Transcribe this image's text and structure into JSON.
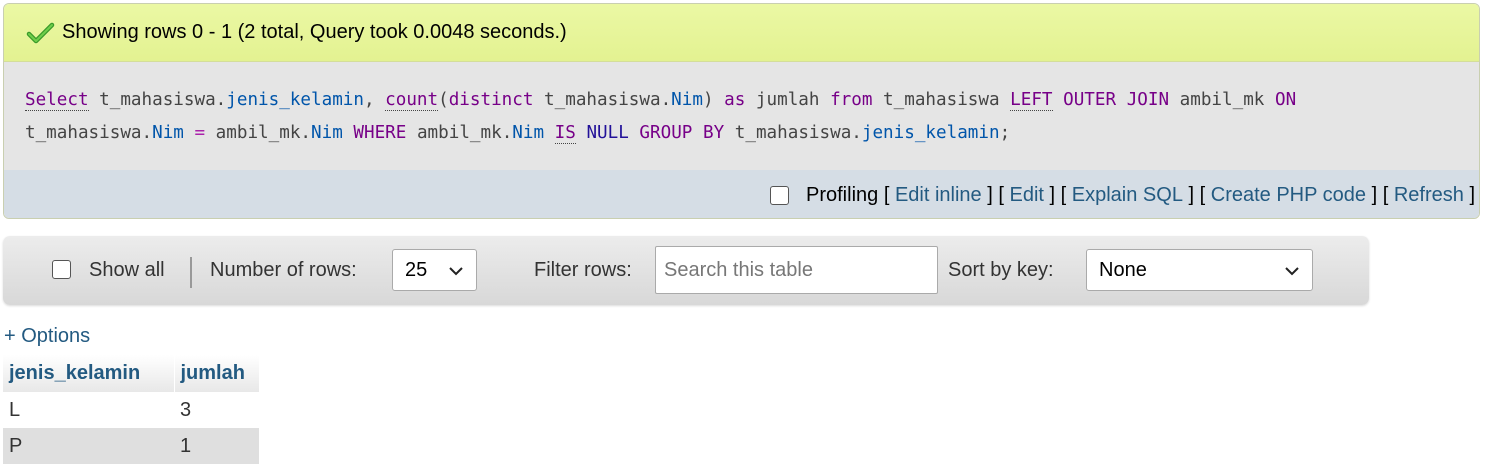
{
  "status": {
    "message": "Showing rows 0 - 1 (2 total, Query took 0.0048 seconds.)",
    "icon": "check-icon",
    "color": "#ebf8a4"
  },
  "sql": {
    "t1_select": "Select",
    "t2": " t_mahasiswa.",
    "t3_col": "jenis_kelamin",
    "t4": ", ",
    "t5_count": "count",
    "t6": "(",
    "t7_distinct": "distinct",
    "t8": " t_mahasiswa.",
    "t9_col": "Nim",
    "t10": ") ",
    "t11_as": "as",
    "t12": " jumlah ",
    "t13_from": "from",
    "t14": " t_mahasiswa ",
    "t15_left": "LEFT",
    "t16": " ",
    "t17_outer": "OUTER",
    "t18": " ",
    "t19_join": "JOIN",
    "t20": " ambil_mk ",
    "t21_on": "ON",
    "l2_t1": "t_mahasiswa.",
    "l2_t2_col": "Nim",
    "l2_t3": " ",
    "l2_t4_eq": "=",
    "l2_t5": " ambil_mk.",
    "l2_t6_col": "Nim",
    "l2_t7": " ",
    "l2_t8_where": "WHERE",
    "l2_t9": " ambil_mk.",
    "l2_t10_col": "Nim",
    "l2_t11": " ",
    "l2_t12_is": "IS",
    "l2_t13": " ",
    "l2_t14_null": "NULL",
    "l2_t15": " ",
    "l2_t16_group": "GROUP",
    "l2_t17": " ",
    "l2_t18_by": "BY",
    "l2_t19": " t_mahasiswa.",
    "l2_t20_col": "jenis_kelamin",
    "l2_t21": ";"
  },
  "tools": {
    "profiling": "Profiling",
    "bracket_open": "[",
    "bracket_close": "]",
    "edit_inline": "Edit inline",
    "edit": "Edit",
    "explain": "Explain SQL",
    "create_php": "Create PHP code",
    "refresh": "Refresh"
  },
  "nav": {
    "show_all": "Show all",
    "rows_label": "Number of rows:",
    "rows_value": "25",
    "filter_label": "Filter rows:",
    "search_placeholder": "Search this table",
    "sort_label": "Sort by key:",
    "sort_value": "None"
  },
  "options_link": "+ Options",
  "table": {
    "headers": [
      "jenis_kelamin",
      "jumlah"
    ],
    "rows": [
      [
        "L",
        "3"
      ],
      [
        "P",
        "1"
      ]
    ]
  }
}
